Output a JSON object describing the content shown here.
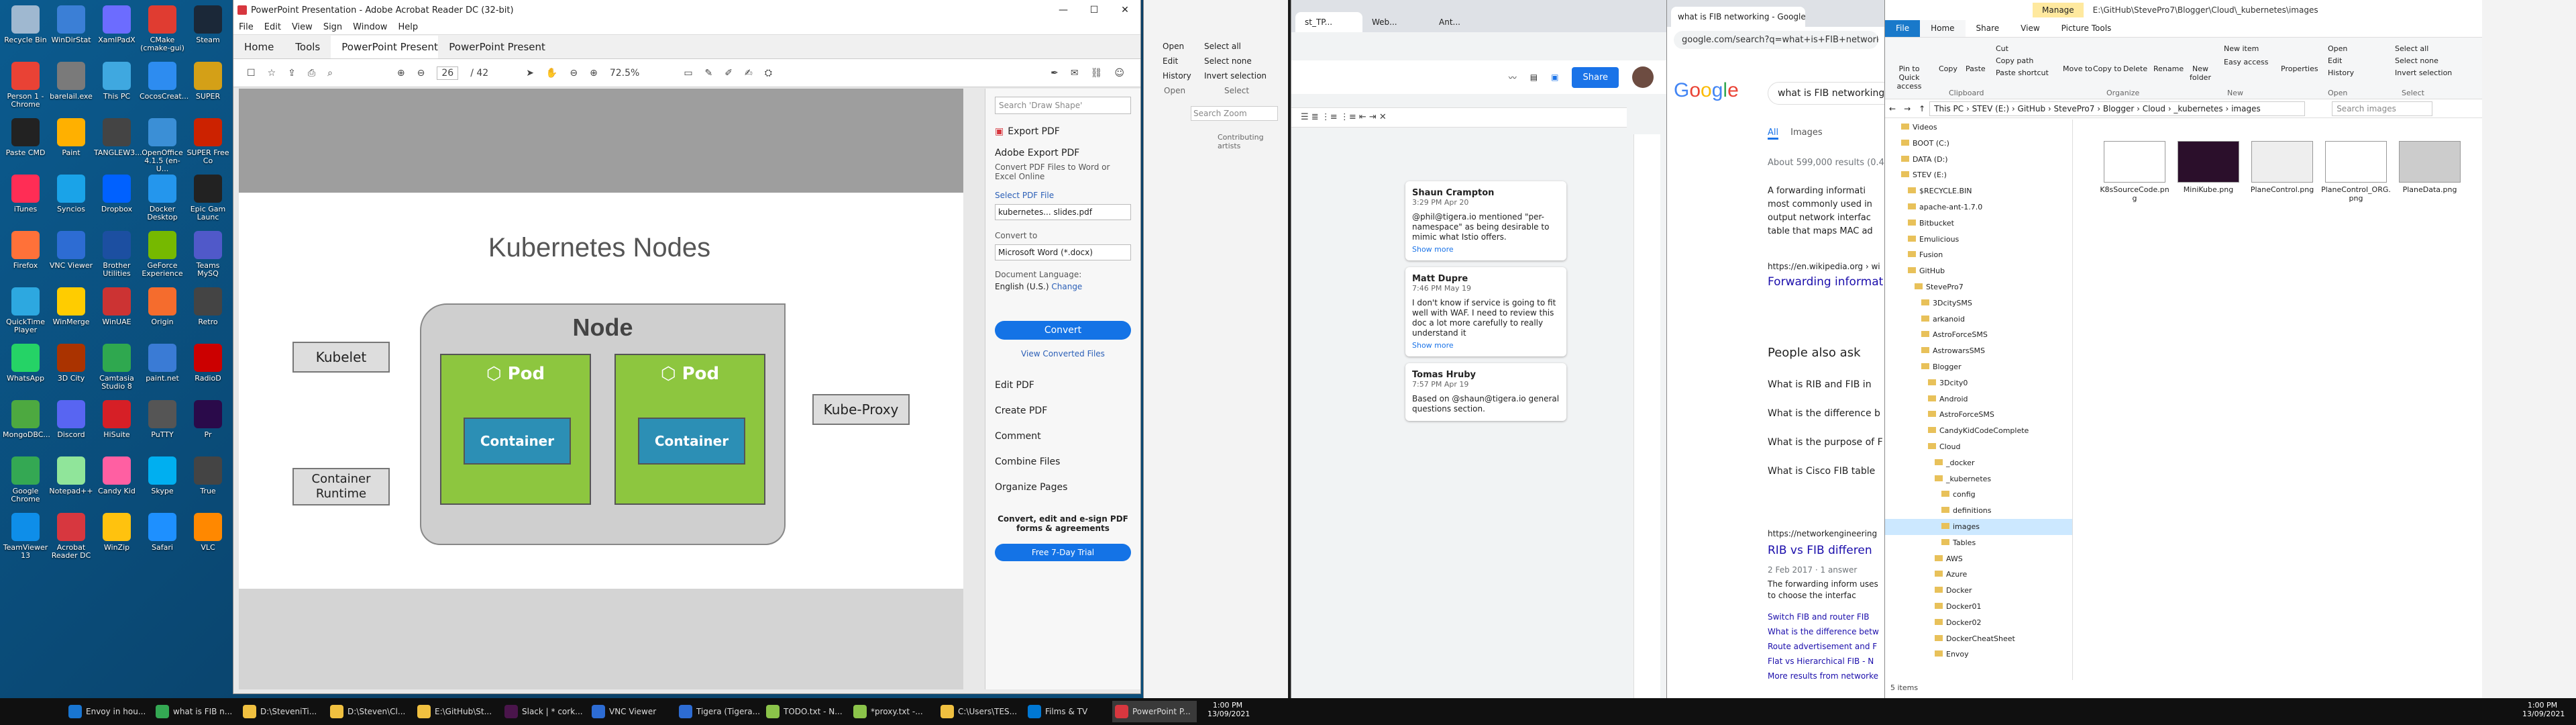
{
  "desktop": {
    "icons": [
      {
        "label": "Recycle Bin",
        "color": "#9fb8d0"
      },
      {
        "label": "WinDirStat",
        "color": "#3b7fd6"
      },
      {
        "label": "XamlPadX",
        "color": "#6c6cff"
      },
      {
        "label": "CMake (cmake-gui)",
        "color": "#e03c31"
      },
      {
        "label": "Steam",
        "color": "#1b2838"
      },
      {
        "label": "Person 1 - Chrome",
        "color": "#e94235"
      },
      {
        "label": "barelail.exe",
        "color": "#7a7a7a"
      },
      {
        "label": "This PC",
        "color": "#3fa8e0"
      },
      {
        "label": "CocosCreat...",
        "color": "#2d8cf0"
      },
      {
        "label": "SUPER",
        "color": "#d4a017"
      },
      {
        "label": "Paste CMD",
        "color": "#222"
      },
      {
        "label": "Paint",
        "color": "#ffb000"
      },
      {
        "label": "TANGLEW3...",
        "color": "#444"
      },
      {
        "label": "OpenOffice 4.1.5 (en-U...",
        "color": "#3b8fd6"
      },
      {
        "label": "SUPER Free Co",
        "color": "#cc2200"
      },
      {
        "label": "iTunes",
        "color": "#ff2d55"
      },
      {
        "label": "Syncios",
        "color": "#1aa3e8"
      },
      {
        "label": "Dropbox",
        "color": "#0061ff"
      },
      {
        "label": "Docker Desktop",
        "color": "#2496ed"
      },
      {
        "label": "Epic Gam Launc",
        "color": "#222"
      },
      {
        "label": "Firefox",
        "color": "#ff7139"
      },
      {
        "label": "VNC Viewer",
        "color": "#2d6cd3"
      },
      {
        "label": "Brother Utilities",
        "color": "#1c4fa1"
      },
      {
        "label": "GeForce Experience",
        "color": "#76b900"
      },
      {
        "label": "Teams MySQ",
        "color": "#5059c9"
      },
      {
        "label": "QuickTime Player",
        "color": "#2da8e0"
      },
      {
        "label": "WinMerge",
        "color": "#ffcc00"
      },
      {
        "label": "WinUAE",
        "color": "#cc3333"
      },
      {
        "label": "Origin",
        "color": "#f56c2d"
      },
      {
        "label": "Retro",
        "color": "#444"
      },
      {
        "label": "WhatsApp",
        "color": "#25d366"
      },
      {
        "label": "3D City",
        "color": "#aa3300"
      },
      {
        "label": "Camtasia Studio 8",
        "color": "#2fa84f"
      },
      {
        "label": "paint.net",
        "color": "#3a7bd5"
      },
      {
        "label": "RadioD",
        "color": "#cc0000"
      },
      {
        "label": "MongoDBC...",
        "color": "#4da940"
      },
      {
        "label": "Discord",
        "color": "#5865f2"
      },
      {
        "label": "HiSuite",
        "color": "#d61f26"
      },
      {
        "label": "PuTTY",
        "color": "#555"
      },
      {
        "label": "Pr",
        "color": "#2a0a4a"
      },
      {
        "label": "Google Chrome",
        "color": "#34a853"
      },
      {
        "label": "Notepad++",
        "color": "#90e59a"
      },
      {
        "label": "Candy Kid",
        "color": "#ff5fa2"
      },
      {
        "label": "Skype",
        "color": "#00aff0"
      },
      {
        "label": "True",
        "color": "#444"
      },
      {
        "label": "TeamViewer 13",
        "color": "#0e8ee9"
      },
      {
        "label": "Acrobat Reader DC",
        "color": "#d7373f"
      },
      {
        "label": "WinZip",
        "color": "#ffc20e"
      },
      {
        "label": "Safari",
        "color": "#1e90ff"
      },
      {
        "label": "VLC",
        "color": "#ff8800"
      }
    ]
  },
  "acrobat": {
    "title": "PowerPoint Presentation - Adobe Acrobat Reader DC (32-bit)",
    "menu": [
      "File",
      "Edit",
      "View",
      "Sign",
      "Window",
      "Help"
    ],
    "tabs": [
      "Home",
      "Tools",
      "PowerPoint Present...",
      "PowerPoint Present..."
    ],
    "page_current": "26",
    "page_total": "/ 42",
    "zoom": "72.5%",
    "slide": {
      "title": "Kubernetes Nodes",
      "node": "Node",
      "pod1": "Pod",
      "pod2": "Pod",
      "container1": "Container",
      "container2": "Container",
      "kubelet": "Kubelet",
      "runtime": "Container Runtime",
      "proxy": "Kube-Proxy"
    },
    "panel": {
      "search_placeholder": "Search 'Draw Shape'",
      "export": "Export PDF",
      "export_title": "Adobe Export PDF",
      "export_desc": "Convert PDF Files to Word or Excel Online",
      "select_file": "Select PDF File",
      "file_name": "kubernetes... slides.pdf",
      "convert_to": "Convert to",
      "format": "Microsoft Word (*.docx)",
      "doc_lang": "Document Language:",
      "lang": "English (U.S.)",
      "change": "Change",
      "convert": "Convert",
      "view_converted": "View Converted Files",
      "tools": [
        "Edit PDF",
        "Create PDF",
        "Comment",
        "Combine Files",
        "Organize Pages"
      ],
      "promo": "Convert, edit and e-sign PDF forms & agreements",
      "trial": "Free 7-Day Trial"
    }
  },
  "docs": {
    "tabs": [
      "st_TP...",
      "Web...",
      "Ant..."
    ],
    "share": "Share",
    "comments": [
      {
        "name": "Shaun Crampton",
        "time": "3:29 PM Apr 20",
        "text": "@phil@tigera.io mentioned \"per-namespace\" as being desirable to mimic what Istio offers.",
        "more": "Show more"
      },
      {
        "name": "Matt Dupre",
        "time": "7:46 PM May 19",
        "text": "I don't know if service is going to fit well with WAF.  I need to review this doc a lot more carefully to really understand it",
        "more": "Show more"
      },
      {
        "name": "Tomas Hruby",
        "time": "7:57 PM Apr 19",
        "text": "Based on @shaun@tigera.io general questions section.",
        "more": ""
      }
    ]
  },
  "explorer_ribbon": {
    "open": "Open",
    "edit": "Edit",
    "history": "History",
    "select_all": "Select all",
    "select_none": "Select none",
    "invert": "Invert selection",
    "open_grp": "Open",
    "select_grp": "Select",
    "search": "Search Zoom",
    "contrib": "Contributing artists"
  },
  "chrome": {
    "tab": "what is FIB networking - Google",
    "url": "google.com/search?q=what+is+FIB+networking",
    "query": "what is FIB networking",
    "tabs2": [
      "All",
      "Images"
    ],
    "results": "About 599,000 results (0.4",
    "snippet": "A forwarding informati most commonly used in output network interfac table that maps MAC ad",
    "url1": "https://en.wikipedia.org › wi",
    "link1": "Forwarding informat",
    "paa": "People also ask",
    "questions": [
      "What is RIB and FIB in",
      "What is the difference b",
      "What is the purpose of F",
      "What is Cisco FIB table"
    ],
    "url2": "https://networkengineering",
    "link2": "RIB vs FIB differen",
    "date2": "2 Feb 2017 · 1 answer",
    "snip2": "The forwarding inform uses to choose the interfac",
    "sublinks": [
      "Switch FIB and router FIB",
      "What is the difference betw",
      "Route advertisement and F",
      "Flat vs Hierarchical FIB - N",
      "More results from networke"
    ]
  },
  "explorer": {
    "title": "E:\\GitHub\\StevePro7\\Blogger\\Cloud\\_kubernetes\\images",
    "manage": "Manage",
    "picture_tools": "Picture Tools",
    "tabs": [
      "File",
      "Home",
      "Share",
      "View"
    ],
    "ribbon": [
      "Pin to Quick access",
      "Copy",
      "Paste",
      "Cut",
      "Copy path",
      "Paste shortcut",
      "Move to",
      "Copy to",
      "Delete",
      "Rename",
      "New folder",
      "New item",
      "Easy access",
      "Properties",
      "Open",
      "Edit",
      "History",
      "Select all",
      "Select none",
      "Invert selection"
    ],
    "groups": [
      "Clipboard",
      "Organize",
      "New",
      "Open",
      "Select"
    ],
    "path": "This PC › STEV (E:) › GitHub › StevePro7 › Blogger › Cloud › _kubernetes › images",
    "search": "Search images",
    "tree": [
      "Videos",
      "BOOT (C:)",
      "DATA (D:)",
      "STEV (E:)",
      "$RECYCLE.BIN",
      "apache-ant-1.7.0",
      "Bitbucket",
      "Emulicious",
      "Fusion",
      "GitHub",
      "StevePro7",
      "3DcitySMS",
      "arkanoid",
      "AstroForceSMS",
      "AstrowarsSMS",
      "Blogger",
      "3Dcity0",
      "Android",
      "AstroForceSMS",
      "CandyKidCodeComplete",
      "Cloud",
      "_docker",
      "_kubernetes",
      "config",
      "definitions",
      "images",
      "Tables",
      "AWS",
      "Azure",
      "Docker",
      "Docker01",
      "Docker02",
      "DockerCheatSheet",
      "Envoy"
    ],
    "files": [
      "K8sSourceCode.png",
      "MiniKube.png",
      "PlaneControl.png",
      "PlaneControl_ORG.png",
      "PlaneData.png"
    ],
    "status": "5 items"
  },
  "taskbar": {
    "items": [
      "Envoy in hou...",
      "what is FIB n...",
      "D:\\SteveniTi...",
      "D:\\Steven\\Cl...",
      "E:\\GitHub\\St...",
      "Slack | * cork...",
      "VNC Viewer",
      "Tigera (Tigera...",
      "TODO.txt - N...",
      "*proxy.txt -...",
      "C:\\Users\\TES...",
      "Films & TV",
      "PowerPoint P..."
    ],
    "time": "1:00 PM",
    "date": "13/09/2021"
  }
}
